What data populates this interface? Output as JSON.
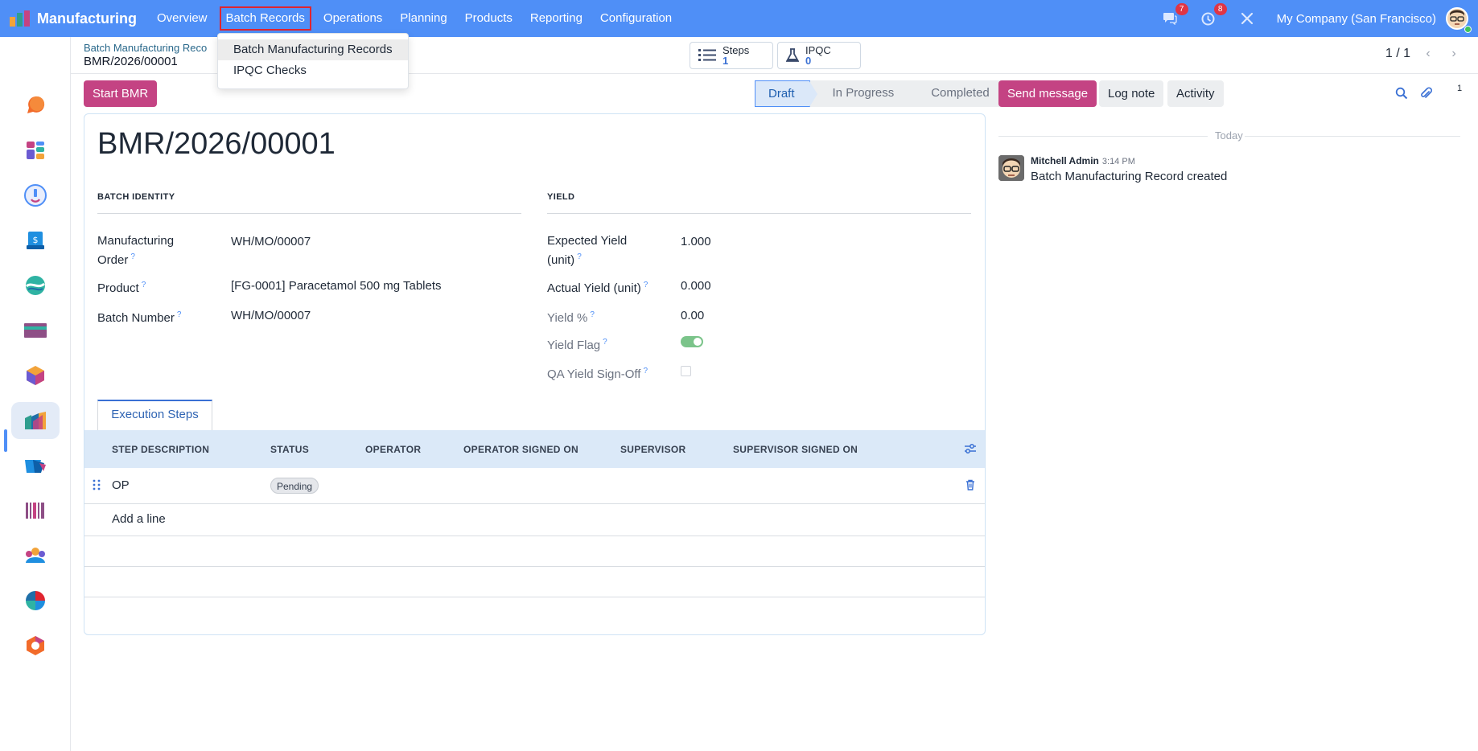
{
  "app": {
    "name": "Manufacturing",
    "colors": {
      "navbar": "#4f8ff7",
      "primary_button": "#c44383",
      "accent": "#3a70d4"
    }
  },
  "nav": {
    "items": [
      "Overview",
      "Batch Records",
      "Operations",
      "Planning",
      "Products",
      "Reporting",
      "Configuration"
    ],
    "active": "Batch Records"
  },
  "topright": {
    "messages_count": "7",
    "activities_count": "8",
    "company": "My Company (San Francisco)"
  },
  "dropdown": {
    "items": [
      "Batch Manufacturing Records",
      "IPQC Checks"
    ],
    "hovered": "Batch Manufacturing Records"
  },
  "breadcrumb": {
    "parent": "Batch Manufacturing Reco",
    "current": "BMR/2026/00001"
  },
  "smart_buttons": {
    "steps": {
      "label": "Steps",
      "value": "1",
      "icon": "list-icon"
    },
    "ipqc": {
      "label": "IPQC",
      "value": "0",
      "icon": "flask-icon"
    }
  },
  "pager": {
    "text": "1 / 1"
  },
  "actions": {
    "start_label": "Start BMR"
  },
  "statusbar": {
    "stages": [
      "Draft",
      "In Progress",
      "Completed"
    ],
    "current": "Draft"
  },
  "record": {
    "title": "BMR/2026/00001",
    "batch_identity": {
      "title": "BATCH IDENTITY",
      "mo_label_1": "Manufacturing",
      "mo_label_2": "Order",
      "mo_value": "WH/MO/00007",
      "product_label": "Product",
      "product_value": "[FG-0001] Paracetamol 500 mg Tablets",
      "batch_label": "Batch Number",
      "batch_value": "WH/MO/00007"
    },
    "yield": {
      "title": "YIELD",
      "expected_label_1": "Expected Yield",
      "expected_label_2": "(unit)",
      "expected_value": "1.000",
      "actual_label": "Actual Yield (unit)",
      "actual_value": "0.000",
      "percent_label": "Yield %",
      "percent_value": "0.00",
      "flag_label": "Yield Flag",
      "flag_on": true,
      "signoff_label": "QA Yield Sign-Off",
      "signoff_checked": false
    },
    "help_mark": "?"
  },
  "tabs": {
    "execution_steps": "Execution Steps"
  },
  "steps_table": {
    "columns": [
      "STEP DESCRIPTION",
      "STATUS",
      "OPERATOR",
      "OPERATOR SIGNED ON",
      "SUPERVISOR",
      "SUPERVISOR SIGNED ON"
    ],
    "rows": [
      {
        "description": "OP",
        "status": "Pending"
      }
    ],
    "add_line": "Add a line"
  },
  "chatter": {
    "send_message": "Send message",
    "log_note": "Log note",
    "activity": "Activity",
    "followers_count": "1",
    "date_separator": "Today",
    "messages": [
      {
        "author": "Mitchell Admin",
        "time": "3:14 PM",
        "body": "Batch Manufacturing Record created"
      }
    ]
  }
}
